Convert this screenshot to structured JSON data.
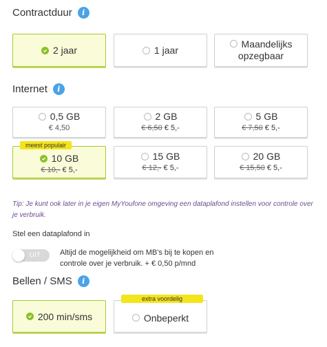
{
  "contract": {
    "title": "Contractduur",
    "options": [
      {
        "label": "2 jaar",
        "selected": true
      },
      {
        "label": "1 jaar",
        "selected": false
      },
      {
        "label": "Maandelijks opzegbaar",
        "selected": false
      }
    ]
  },
  "internet": {
    "title": "Internet",
    "badge": "meest populair",
    "options": [
      {
        "label": "0,5 GB",
        "price": "€ 4,50",
        "old_price": "",
        "new_price": "",
        "selected": false
      },
      {
        "label": "2 GB",
        "price": "",
        "old_price": "€ 6,50",
        "new_price": "€ 5,-",
        "selected": false
      },
      {
        "label": "5 GB",
        "price": "",
        "old_price": "€ 7,50",
        "new_price": "€ 5,-",
        "selected": false
      },
      {
        "label": "10 GB",
        "price": "",
        "old_price": "€ 10,-",
        "new_price": "€ 5,-",
        "selected": true
      },
      {
        "label": "15 GB",
        "price": "",
        "old_price": "€ 12,-",
        "new_price": "€ 5,-",
        "selected": false
      },
      {
        "label": "20 GB",
        "price": "",
        "old_price": "€ 15,50",
        "new_price": "€ 5,-",
        "selected": false
      }
    ]
  },
  "tip": "Tip: Je kunt ook later in je eigen MyYoufone omgeving een dataplafond instellen voor controle over je verbruik.",
  "dataplafond": {
    "label": "Stel een dataplafond in",
    "toggle_text": "UIT",
    "description": "Altijd de mogelijkheid om MB's bij te kopen en controle over je verbruik. + € 0,50 p/mnd"
  },
  "bellen": {
    "title": "Bellen / SMS",
    "badge": "extra voordelig",
    "options": [
      {
        "label": "200 min/sms",
        "selected": true
      },
      {
        "label": "Onbeperkt",
        "selected": false
      }
    ]
  },
  "colors": {
    "selected_bg": "#fafcd9",
    "selected_border": "#a7c830",
    "check": "#8cbf2b",
    "info": "#4aa3e8",
    "badge": "#f4e41c",
    "tip": "#6a4d8f"
  }
}
